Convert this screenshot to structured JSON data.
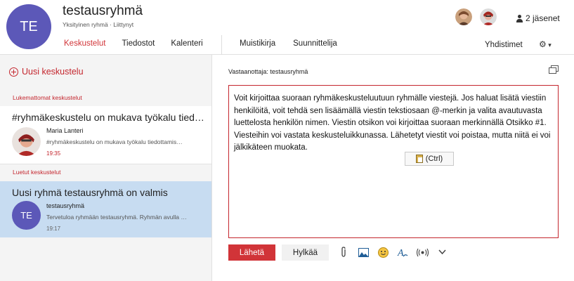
{
  "header": {
    "avatar_initials": "TE",
    "group_name": "testausryhmä",
    "group_meta": "Yksityinen ryhmä  ·  Liittynyt",
    "members_label": "2 jäsenet"
  },
  "tabs": [
    "Keskustelut",
    "Tiedostot",
    "Kalenteri"
  ],
  "tabs_secondary": [
    "Muistikirja",
    "Suunnittelija"
  ],
  "connectors_label": "Yhdistimet",
  "left_pane": {
    "new_conversation": "Uusi keskustelu",
    "unread_label": "Lukemattomat keskustelut",
    "read_label": "Luetut keskustelut",
    "unread": [
      {
        "title": "#ryhmäkeskustelu on mukava työkalu tied…",
        "sender": "Maria Lanteri",
        "preview": "#ryhmäkeskustelu on mukava työkalu tiedottamis…",
        "time": "19:35"
      }
    ],
    "read": [
      {
        "title": "Uusi ryhmä testausryhmä on valmis",
        "avatar": "TE",
        "sender": "testausryhmä",
        "preview": "Tervetuloa ryhmään testausryhmä. Ryhmän avulla …",
        "time": "19:17"
      }
    ]
  },
  "compose": {
    "recipient_label": "Vastaanottaja:",
    "recipient": "testausryhmä",
    "body": "Voit kirjoittaa suoraan ryhmäkeskusteluutuun ryhmälle viestejä. Jos haluat lisätä viestiin henkilöitä, voit tehdä sen lisäämällä viestin tekstiosaan @-merkin ja valita avautuvasta luettelosta henkilön nimen. Viestin otsikon voi kirjoittaa suoraan merkinnällä Otsikko #1. Viesteihin voi vastata keskusteluikkunassa. Lähetetyt viestit voi poistaa, mutta niitä ei voi jälkikäteen muokata.",
    "paste_label": "(Ctrl)",
    "send_label": "Lähetä",
    "discard_label": "Hylkää"
  },
  "colors": {
    "accent": "#d13438",
    "avatar": "#5c58b8",
    "selected": "#c7dcf1"
  },
  "icons": [
    "people-icon",
    "gear-icon",
    "plus-circle-icon",
    "popout-icon",
    "paste-icon",
    "attach-icon",
    "image-icon",
    "emoji-icon",
    "format-icon",
    "praise-icon",
    "more-icon"
  ]
}
